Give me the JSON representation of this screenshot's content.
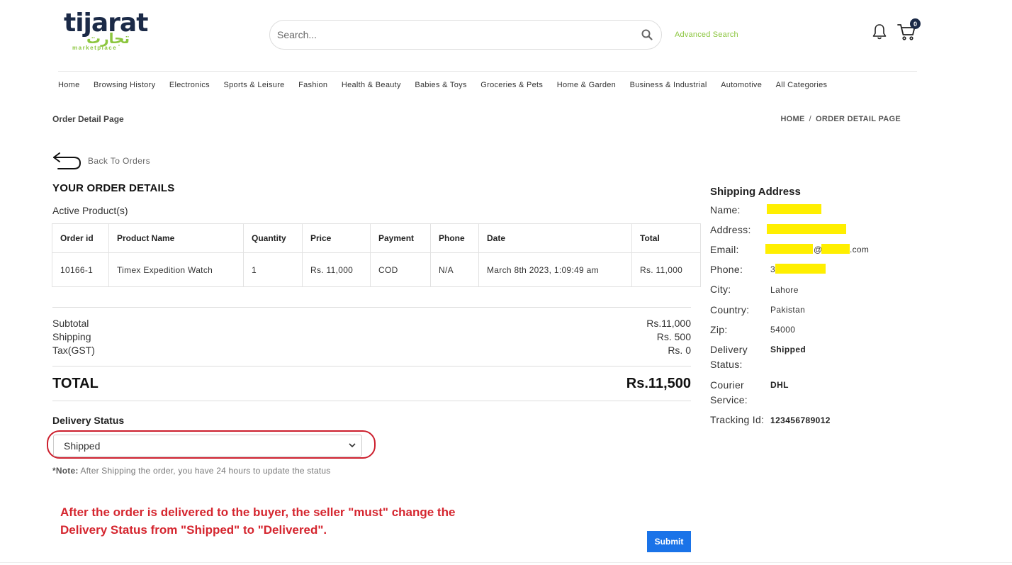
{
  "header": {
    "logo_en": "tijarat",
    "logo_ar": "تجارت",
    "logo_sub": "marketplace",
    "search_placeholder": "Search...",
    "advanced_search": "Advanced Search",
    "cart_count": "0"
  },
  "nav": [
    "Home",
    "Browsing History",
    "Electronics",
    "Sports & Leisure",
    "Fashion",
    "Health & Beauty",
    "Babies & Toys",
    "Groceries & Pets",
    "Home & Garden",
    "Business & Industrial",
    "Automotive",
    "All Categories"
  ],
  "page": {
    "title": "Order Detail Page",
    "breadcrumb_home": "HOME",
    "breadcrumb_sep": "/",
    "breadcrumb_current": "ORDER DETAIL PAGE",
    "back": "Back To Orders"
  },
  "order": {
    "heading": "YOUR ORDER DETAILS",
    "section": "Active Product(s)",
    "columns": [
      "Order id",
      "Product Name",
      "Quantity",
      "Price",
      "Payment",
      "Phone",
      "Date",
      "Total"
    ],
    "rows": [
      [
        "10166-1",
        "Timex Expedition Watch",
        "1",
        "Rs. 11,000",
        "COD",
        "N/A",
        "March 8th 2023, 1:09:49 am",
        "Rs. 11,000"
      ]
    ]
  },
  "summary": {
    "subtotal_label": "Subtotal",
    "subtotal_value": "Rs.11,000",
    "shipping_label": "Shipping",
    "shipping_value": "Rs. 500",
    "tax_label": "Tax(GST)",
    "tax_value": "Rs. 0",
    "total_label": "TOTAL",
    "total_value": "Rs.11,500"
  },
  "delivery": {
    "label": "Delivery Status",
    "selected": "Shipped",
    "note_bold": "*Note:",
    "note": " After Shipping the order, you have 24 hours to update the status",
    "annotation_line1": "After the order is delivered to the buyer, the seller \"must\" change the",
    "annotation_line2": "Delivery Status from \"Shipped\" to \"Delivered\".",
    "submit": "Submit"
  },
  "shipping": {
    "title": "Shipping Address",
    "name_label": "Name:",
    "address_label": "Address:",
    "email_label": "Email:",
    "email_at": "@",
    "email_domain": ".com",
    "phone_label": "Phone:",
    "phone_prefix": "3",
    "city_label": "City:",
    "city": "Lahore",
    "country_label": "Country:",
    "country": "Pakistan",
    "zip_label": "Zip:",
    "zip": "54000",
    "delivery_label_1": "Delivery",
    "delivery_label_2": "Status:",
    "delivery_status": "Shipped",
    "courier_label_1": "Courier",
    "courier_label_2": "Service:",
    "courier": "DHL",
    "tracking_label": "Tracking Id:",
    "tracking_id": "123456789012",
    "redaction_color": "#ffef00"
  }
}
